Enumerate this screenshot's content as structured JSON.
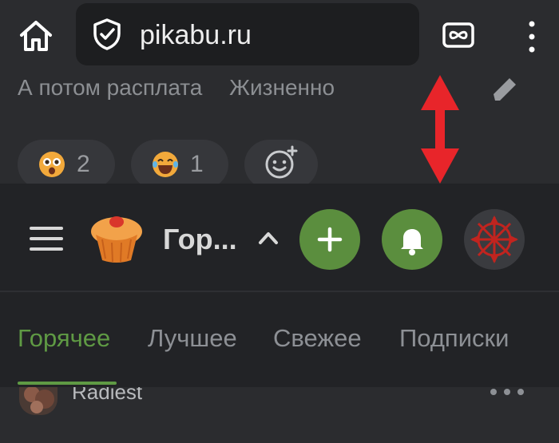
{
  "browser": {
    "url": "pikabu.ru",
    "home_icon": "home-icon",
    "security_icon": "shield-check-icon",
    "tabs_icon": "tab-switcher-icon",
    "menu_icon": "more-vertical-icon"
  },
  "post": {
    "tags": [
      "А потом расплата",
      "Жизненно"
    ],
    "reactions": [
      {
        "icon": "shocked-face-icon",
        "count": "2"
      },
      {
        "icon": "laughing-tears-face-icon",
        "count": "1"
      },
      {
        "icon": "add-reaction-icon"
      }
    ]
  },
  "header": {
    "section_title": "Гор...",
    "tabs": [
      {
        "label": "Горячее",
        "active": true
      },
      {
        "label": "Лучшее",
        "active": false
      },
      {
        "label": "Свежее",
        "active": false
      },
      {
        "label": "Подписки",
        "active": false
      }
    ]
  },
  "feed": {
    "next_author": "Radiest"
  },
  "colors": {
    "accent": "#5f9a44",
    "button_green": "#5b8e3e",
    "annotation_arrow": "#e8252a"
  }
}
